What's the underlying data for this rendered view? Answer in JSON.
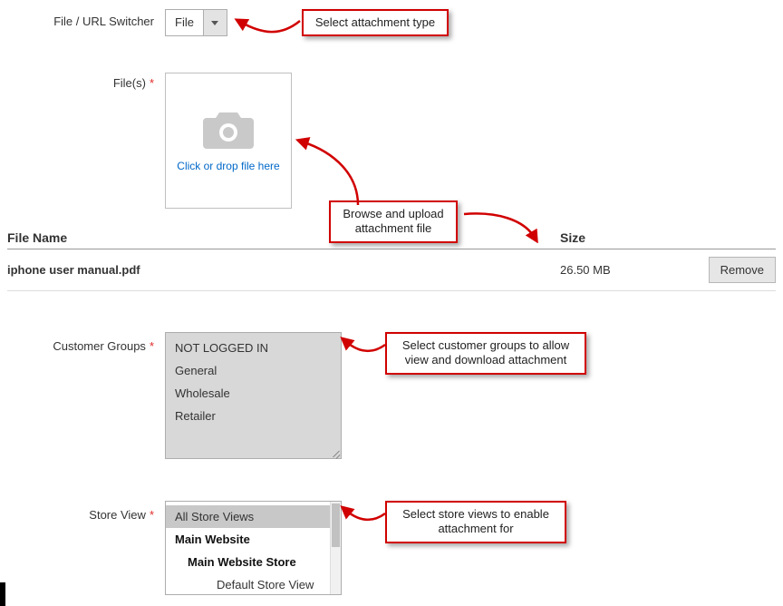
{
  "switcher": {
    "label": "File / URL Switcher",
    "value": "File"
  },
  "files": {
    "label": "File(s)",
    "upload_text": "Click or drop file here"
  },
  "table": {
    "col_name": "File Name",
    "col_size": "Size",
    "name": "iphone user manual.pdf",
    "size": "26.50 MB",
    "remove": "Remove"
  },
  "customer_groups": {
    "label": "Customer Groups",
    "options": [
      "NOT LOGGED IN",
      "General",
      "Wholesale",
      "Retailer"
    ]
  },
  "store_view": {
    "label": "Store View",
    "l0": "All Store Views",
    "l1": "Main Website",
    "l2": "Main Website Store",
    "l3": "Default Store View"
  },
  "annotations": {
    "a1": "Select attachment type",
    "a2_l1": "Browse and upload",
    "a2_l2": "attachment file",
    "a3_l1": "Select customer groups to allow",
    "a3_l2": "view and download attachment",
    "a4_l1": "Select store views to enable",
    "a4_l2": "attachment for"
  }
}
